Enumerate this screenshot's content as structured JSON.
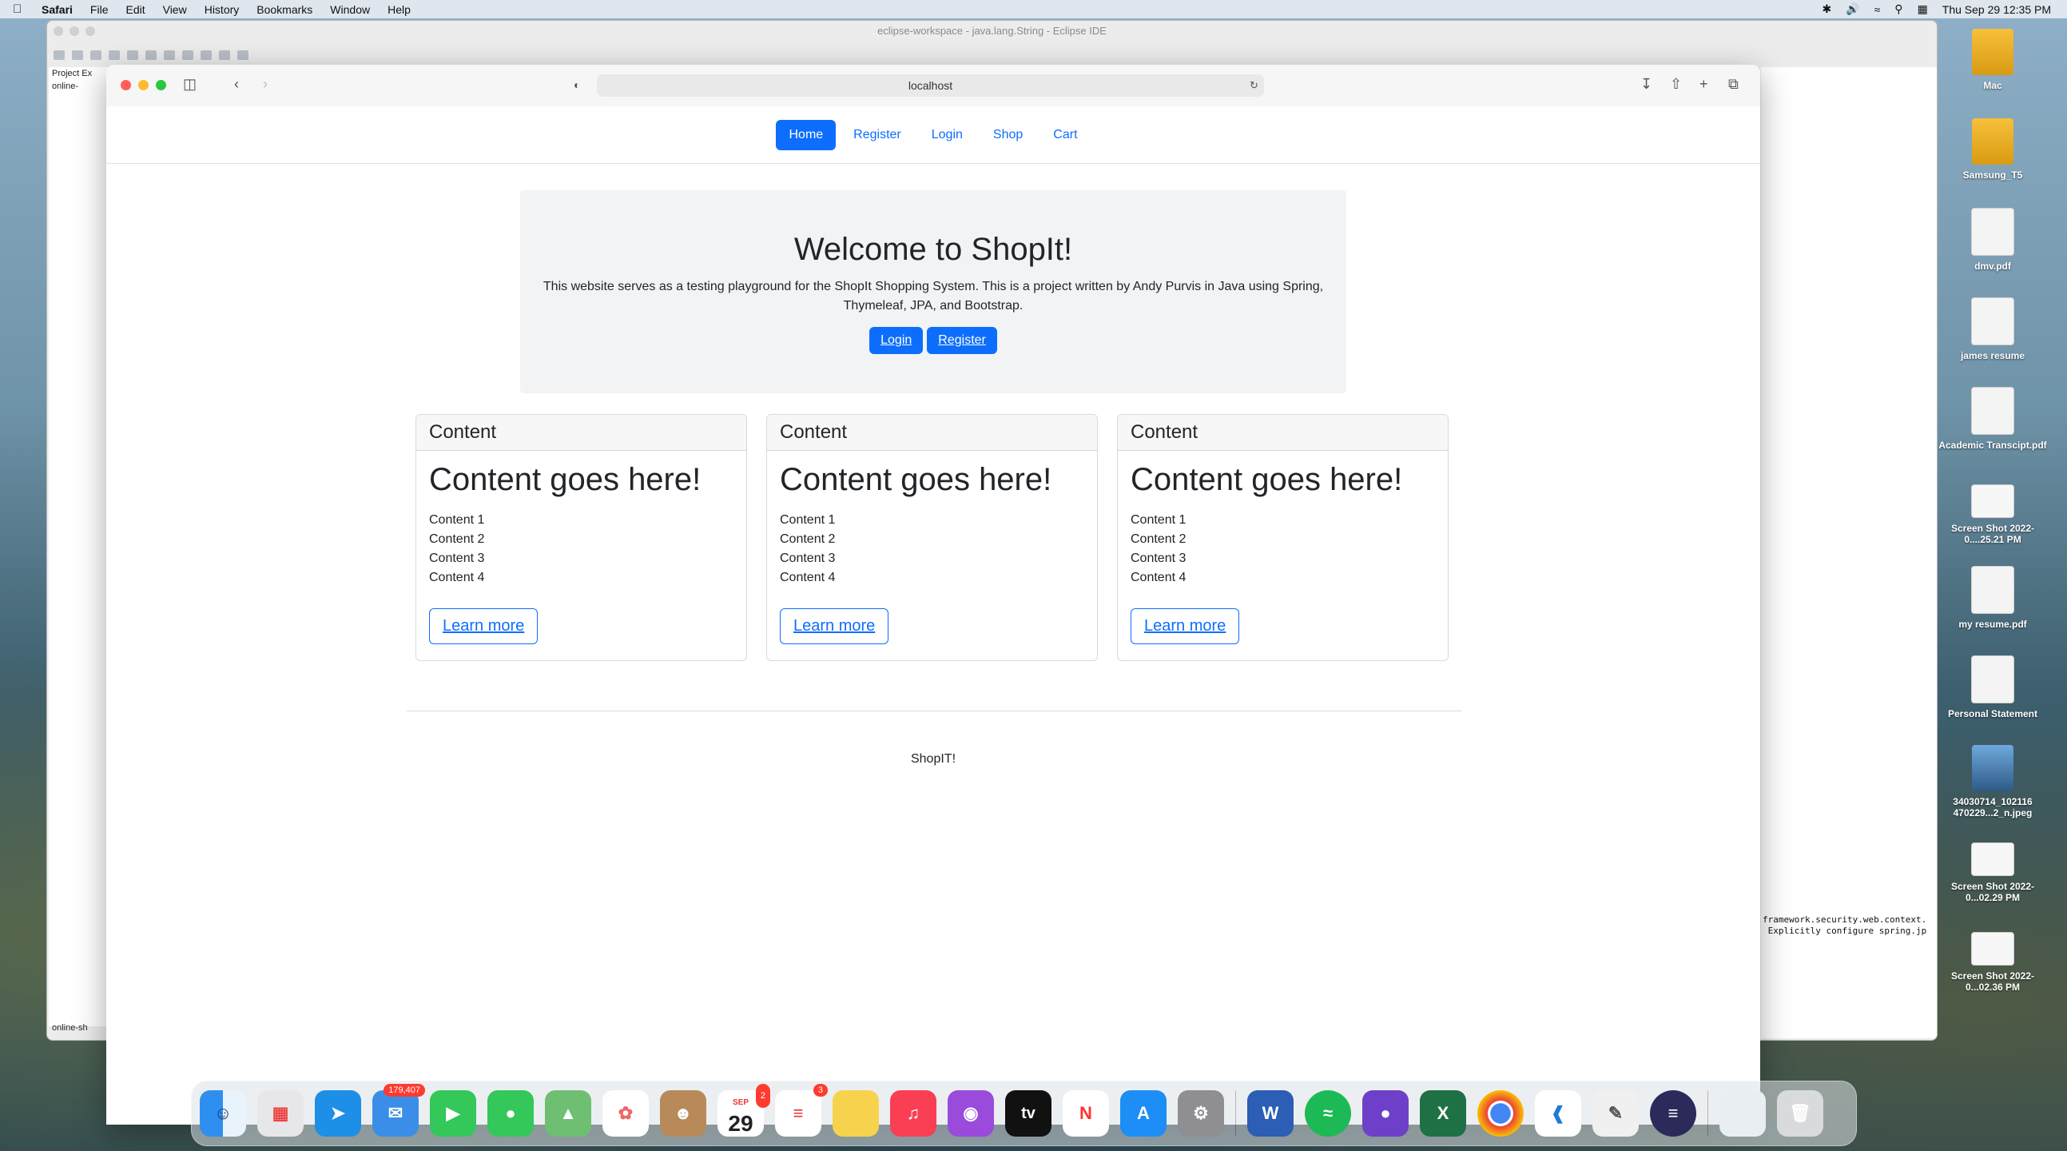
{
  "menubar": {
    "app_name": "Safari",
    "items": [
      "File",
      "Edit",
      "View",
      "History",
      "Bookmarks",
      "Window",
      "Help"
    ],
    "clock": "Thu Sep 29  12:35 PM"
  },
  "eclipse": {
    "title": "eclipse-workspace - java.lang.String - Eclipse IDE",
    "explorer_tab": "Project Ex",
    "explorer_item": "online-",
    "status_item": "online-sh",
    "console_line1": "framework.security.web.context.",
    "console_line2": " Explicitly configure spring.jp"
  },
  "safari": {
    "url": "localhost"
  },
  "site": {
    "nav": [
      "Home",
      "Register",
      "Login",
      "Shop",
      "Cart"
    ],
    "hero_title": "Welcome to ShopIt!",
    "hero_text": "This website serves as a testing playground for the ShopIt Shopping System. This is a project written by Andy Purvis in Java using Spring, Thymeleaf, JPA, and Bootstrap.",
    "hero_login": "Login",
    "hero_register": "Register",
    "cards": [
      {
        "header": "Content",
        "title": "Content goes here!",
        "items": [
          "Content 1",
          "Content 2",
          "Content 3",
          "Content 4"
        ],
        "button": "Learn more"
      },
      {
        "header": "Content",
        "title": "Content goes here!",
        "items": [
          "Content 1",
          "Content 2",
          "Content 3",
          "Content 4"
        ],
        "button": "Learn more"
      },
      {
        "header": "Content",
        "title": "Content goes here!",
        "items": [
          "Content 1",
          "Content 2",
          "Content 3",
          "Content 4"
        ],
        "button": "Learn more"
      }
    ],
    "footer": "ShopIT!"
  },
  "desktop": [
    {
      "label": "Mac",
      "icon": "drive-icon"
    },
    {
      "label": "Samsung_T5",
      "icon": "drive-icon"
    },
    {
      "label": "dmv.pdf",
      "icon": "pdf-icon"
    },
    {
      "label": "james resume",
      "icon": "docx-icon"
    },
    {
      "label": "Academic Transcipt.pdf",
      "icon": "pdf-icon"
    },
    {
      "label": "Screen Shot 2022-0....25.21 PM",
      "icon": "screenshot-icon"
    },
    {
      "label": "my resume.pdf",
      "icon": "pdf-icon"
    },
    {
      "label": "Personal Statement",
      "icon": "docx-icon"
    },
    {
      "label": "34030714_102116 470229...2_n.jpeg",
      "icon": "photo-icon"
    },
    {
      "label": "Screen Shot 2022-0...02.29 PM",
      "icon": "screenshot-icon"
    },
    {
      "label": "Screen Shot 2022-0...02.36 PM",
      "icon": "screenshot-icon"
    }
  ],
  "dock": {
    "mail_badge": "179,407",
    "calendar_month": "SEP",
    "calendar_day": "29",
    "calendar_badge": "2",
    "reminders_badge": "3",
    "tv_label": "tv",
    "word_letter": "W",
    "excel_letter": "X"
  },
  "colors": {
    "primary": "#0d6efd",
    "hero_bg": "#f2f3f5"
  }
}
